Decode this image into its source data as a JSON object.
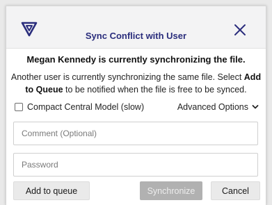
{
  "dialog": {
    "title": "Sync Conflict with User",
    "logo_icon": "brand-logo-icon",
    "close_icon": "close-icon",
    "accent_color": "#2a2d7c"
  },
  "heading": "Megan Kennedy is currently synchronizing the file.",
  "message": {
    "part1": "Another user is currently synchronizing the same file. Select ",
    "bold": "Add to Queue",
    "part2": " to be notified when the file is free to be synced."
  },
  "options": {
    "compact_label": "Compact Central Model (slow)",
    "compact_checked": false,
    "advanced_label": "Advanced Options",
    "advanced_icon": "chevron-down-icon"
  },
  "fields": {
    "comment_placeholder": "Comment (Optional)",
    "comment_value": "",
    "password_placeholder": "Password",
    "password_value": ""
  },
  "buttons": {
    "add_to_queue": "Add to queue",
    "synchronize": "Synchronize",
    "synchronize_enabled": false,
    "cancel": "Cancel"
  }
}
